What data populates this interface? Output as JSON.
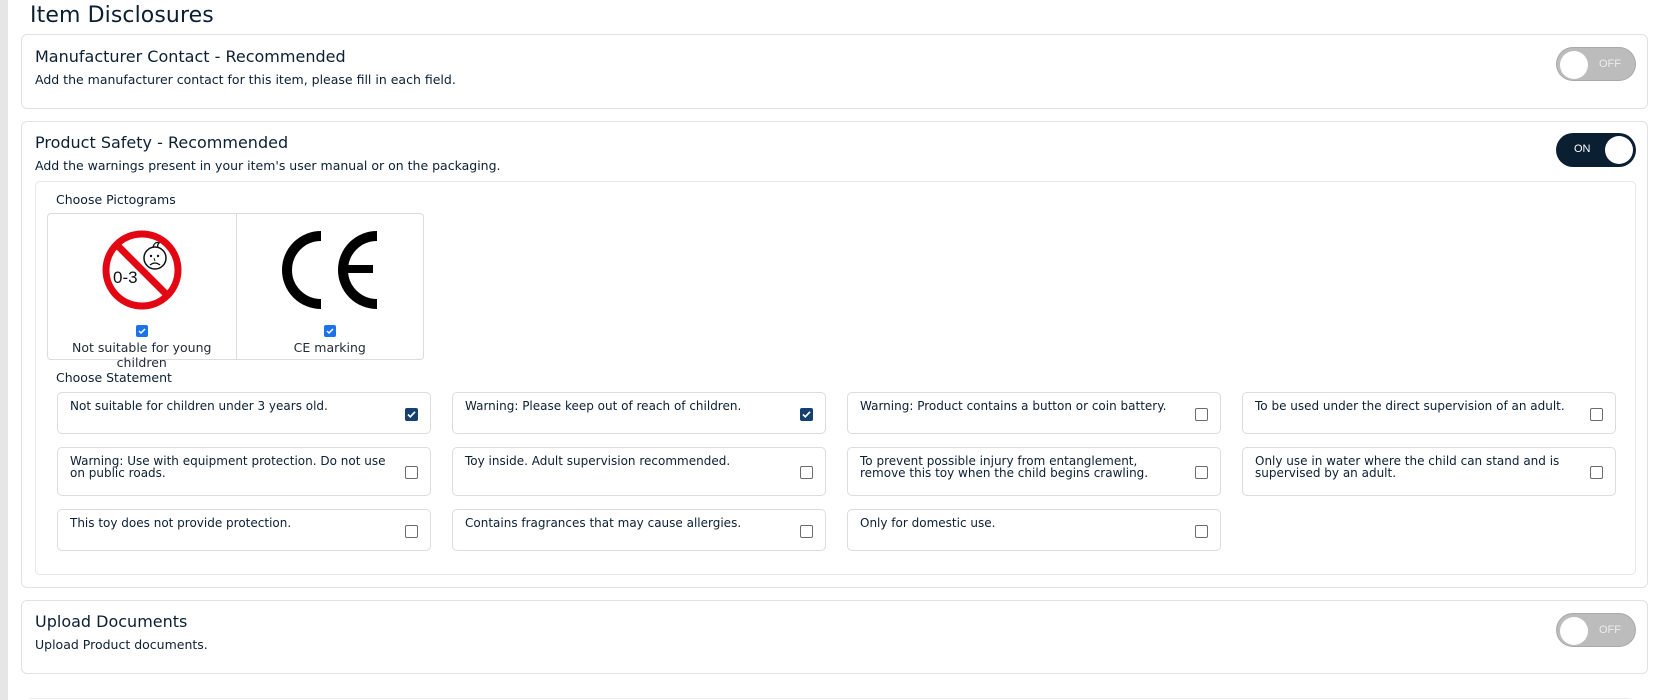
{
  "page": {
    "title": "Item Disclosures"
  },
  "sections": {
    "manufacturer": {
      "title": "Manufacturer Contact - Recommended",
      "subtitle": "Add the manufacturer contact for this item, please fill in each field.",
      "toggle_state": "off",
      "toggle_label": "OFF"
    },
    "safety": {
      "title": "Product Safety - Recommended",
      "subtitle": "Add the warnings present in your item's user manual or on the packaging.",
      "toggle_state": "on",
      "toggle_label": "ON",
      "pictograms_label": "Choose Pictograms",
      "pictograms": [
        {
          "icon": "not-suitable-0-3-icon",
          "label": "Not suitable for young children",
          "checked": true,
          "age_text": "0-3"
        },
        {
          "icon": "ce-marking-icon",
          "label": "CE marking",
          "checked": true
        }
      ],
      "statements_label": "Choose Statement",
      "statements": [
        {
          "text": "Not suitable for children under 3 years old.",
          "checked": true
        },
        {
          "text": "Warning: Please keep out of reach of children.",
          "checked": true
        },
        {
          "text": "Warning: Product contains a button or coin battery.",
          "checked": false
        },
        {
          "text": "To be used under the direct supervision of an adult.",
          "checked": false
        },
        {
          "text": "Warning: Use with equipment protection. Do not use on public roads.",
          "checked": false
        },
        {
          "text": "Toy inside. Adult supervision recommended.",
          "checked": false
        },
        {
          "text": "To prevent possible injury from entanglement, remove this toy when the child begins crawling.",
          "checked": false
        },
        {
          "text": "Only use in water where the child can stand and is supervised by an adult.",
          "checked": false
        },
        {
          "text": "This toy does not provide protection.",
          "checked": false
        },
        {
          "text": "Contains fragrances that may cause allergies.",
          "checked": false
        },
        {
          "text": "Only for domestic use.",
          "checked": false
        }
      ]
    },
    "upload": {
      "title": "Upload Documents",
      "subtitle": "Upload Product documents.",
      "toggle_state": "off",
      "toggle_label": "OFF"
    }
  },
  "colors": {
    "primary_dark": "#0b1f33",
    "checkbox_checked": "#15406f",
    "pictogram_checkbox": "#1a73e8",
    "toggle_off": "#bcbcbc",
    "prohibition_red": "#e30613"
  }
}
